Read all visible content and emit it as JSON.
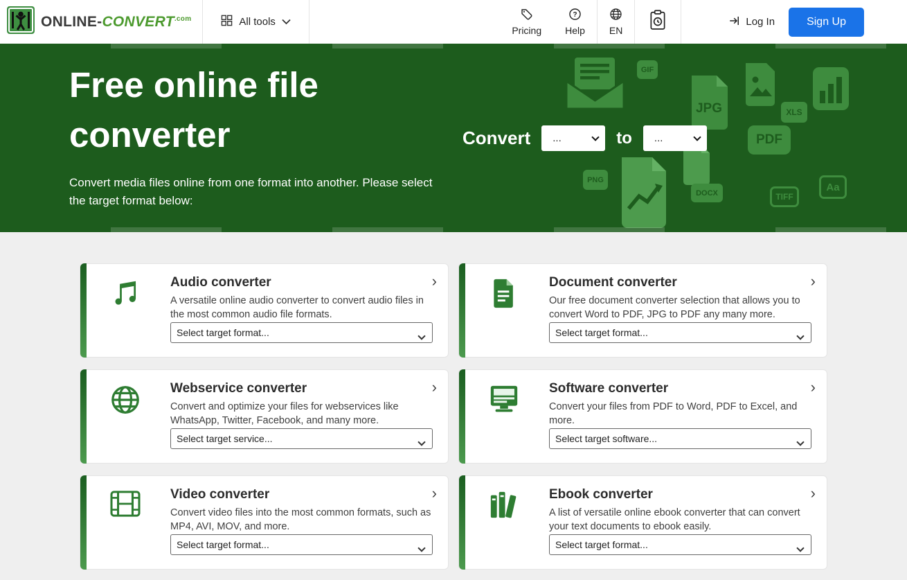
{
  "header": {
    "logo": {
      "part1": "ONLINE",
      "dash": "-",
      "part2": "CONVERT",
      "suffix": ".com"
    },
    "all_tools_label": "All tools",
    "pricing_label": "Pricing",
    "help_label": "Help",
    "language_label": "EN",
    "login_label": "Log In",
    "signup_label": "Sign Up"
  },
  "hero": {
    "title": "Free online file converter",
    "subtitle": "Convert media files online from one format into another. Please select the target format below:",
    "convert_label": "Convert",
    "to_label": "to",
    "source_value": "...",
    "target_value": "...",
    "file_badges": {
      "gif": "GIF",
      "jpg": "JPG",
      "xls": "XLS",
      "pdf": "PDF",
      "png": "PNG",
      "docx": "DOCX",
      "tiff": "TIFF",
      "aa": "Aa"
    }
  },
  "cards": [
    {
      "title": "Audio converter",
      "description": "A versatile online audio converter to convert audio files in the most common audio file formats.",
      "select_label": "Select target format...",
      "icon": "music-note-icon"
    },
    {
      "title": "Document converter",
      "description": "Our free document converter selection that allows you to convert Word to PDF, JPG to PDF any many more.",
      "select_label": "Select target format...",
      "icon": "document-icon"
    },
    {
      "title": "Webservice converter",
      "description": "Convert and optimize your files for webservices like WhatsApp, Twitter, Facebook, and many more.",
      "select_label": "Select target service...",
      "icon": "globe-icon"
    },
    {
      "title": "Software converter",
      "description": "Convert your files from PDF to Word, PDF to Excel, and more.",
      "select_label": "Select target software...",
      "icon": "monitor-icon"
    },
    {
      "title": "Video converter",
      "description": "Convert video files into the most common formats, such as MP4, AVI, MOV, and more.",
      "select_label": "Select target format...",
      "icon": "film-icon"
    },
    {
      "title": "Ebook converter",
      "description": "A list of versatile online ebook converter that can convert your text documents to ebook easily.",
      "select_label": "Select target format...",
      "icon": "books-icon"
    }
  ],
  "colors": {
    "hero_green": "#1d5c1d",
    "brand_green": "#2e7d32",
    "deco_green": "#3e8c3e",
    "signup_blue": "#1a73e8",
    "page_bg": "#efefef"
  }
}
